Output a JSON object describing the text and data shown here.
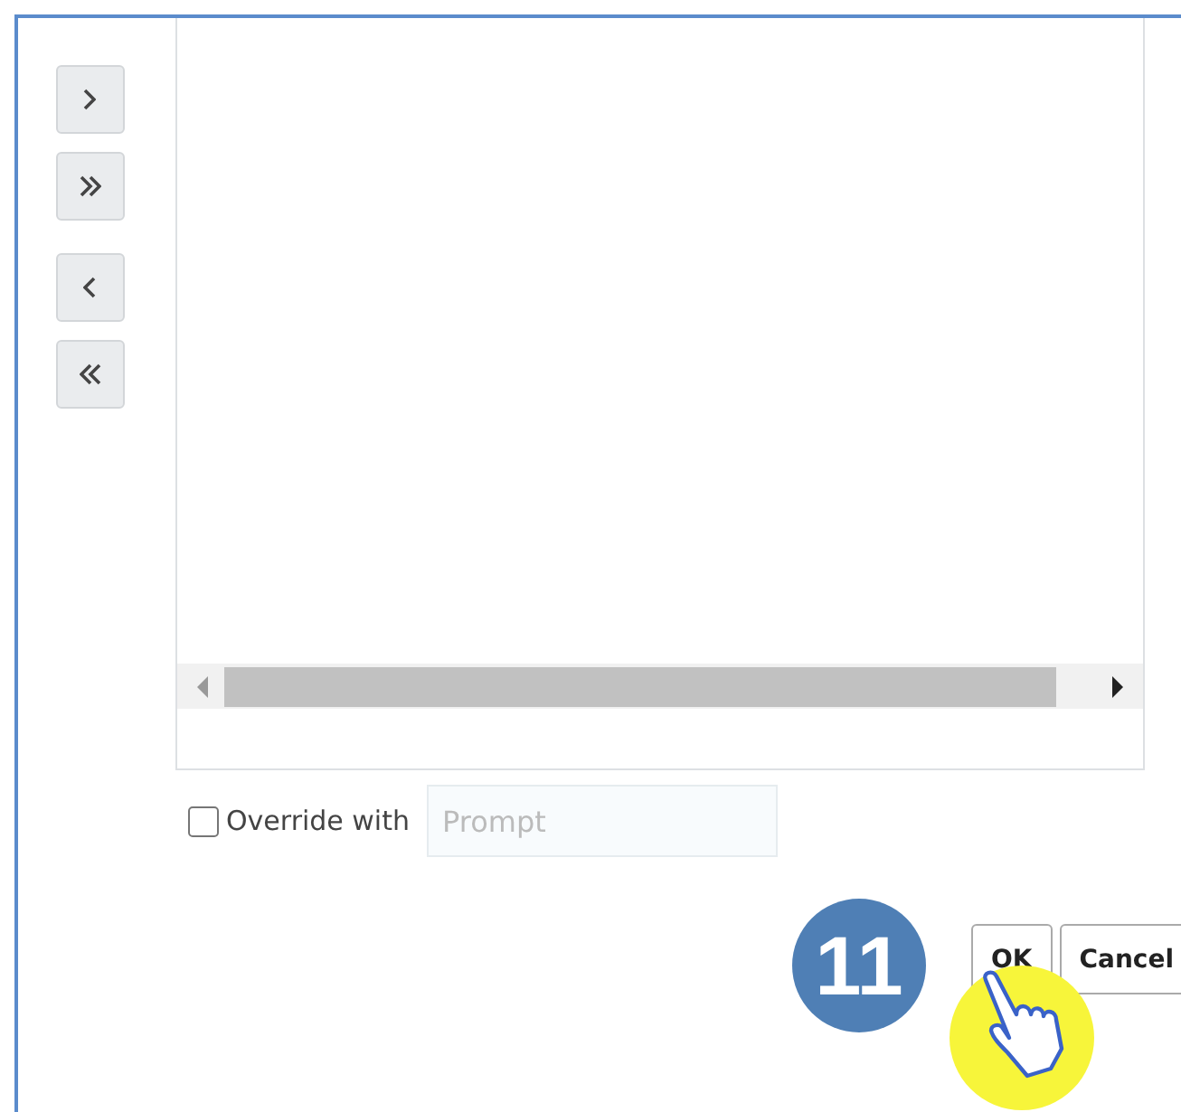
{
  "override": {
    "label": "Override with",
    "checked": false,
    "placeholder": "Prompt"
  },
  "buttons": [
    "OK",
    "Cancel"
  ],
  "step_badge": "11"
}
